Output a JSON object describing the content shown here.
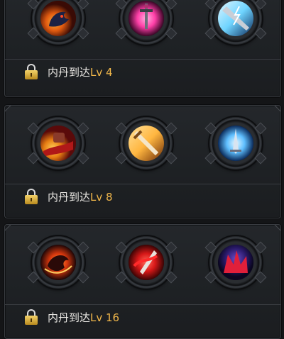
{
  "sections": [
    {
      "skills": [
        {
          "icon": "dark-beast-flame-skill-icon",
          "colors": [
            "#e05a10",
            "#1a1f3c"
          ]
        },
        {
          "icon": "pink-sword-skill-icon",
          "colors": [
            "#ff3fa8",
            "#5a0a3a"
          ]
        },
        {
          "icon": "lightning-blade-skill-icon",
          "colors": [
            "#6fd4ff",
            "#1b4f8a"
          ]
        }
      ],
      "requirement_prefix": "内丹到达",
      "requirement_level": "Lv 4"
    },
    {
      "skills": [
        {
          "icon": "red-fist-slash-skill-icon",
          "colors": [
            "#e67d12",
            "#7a1010"
          ]
        },
        {
          "icon": "flaming-sword-skill-icon",
          "colors": [
            "#ffb640",
            "#8a3a05"
          ]
        },
        {
          "icon": "ice-sword-skill-icon",
          "colors": [
            "#7fd8ff",
            "#103a70"
          ]
        }
      ],
      "requirement_prefix": "内丹到达",
      "requirement_level": "Lv 8"
    },
    {
      "skills": [
        {
          "icon": "fire-beast-skill-icon",
          "colors": [
            "#ff5a1a",
            "#2a0808"
          ]
        },
        {
          "icon": "crimson-blade-skill-icon",
          "colors": [
            "#ff2a2a",
            "#5a0505"
          ]
        },
        {
          "icon": "red-dragon-wing-skill-icon",
          "colors": [
            "#ff2440",
            "#20104a"
          ]
        }
      ],
      "requirement_prefix": "内丹到达",
      "requirement_level": "Lv 16"
    }
  ],
  "colors": {
    "background": "#141517",
    "panel": "#22252a",
    "text": "#e9e7e3",
    "level": "#f2b84b",
    "lock": "#e2b23a"
  }
}
